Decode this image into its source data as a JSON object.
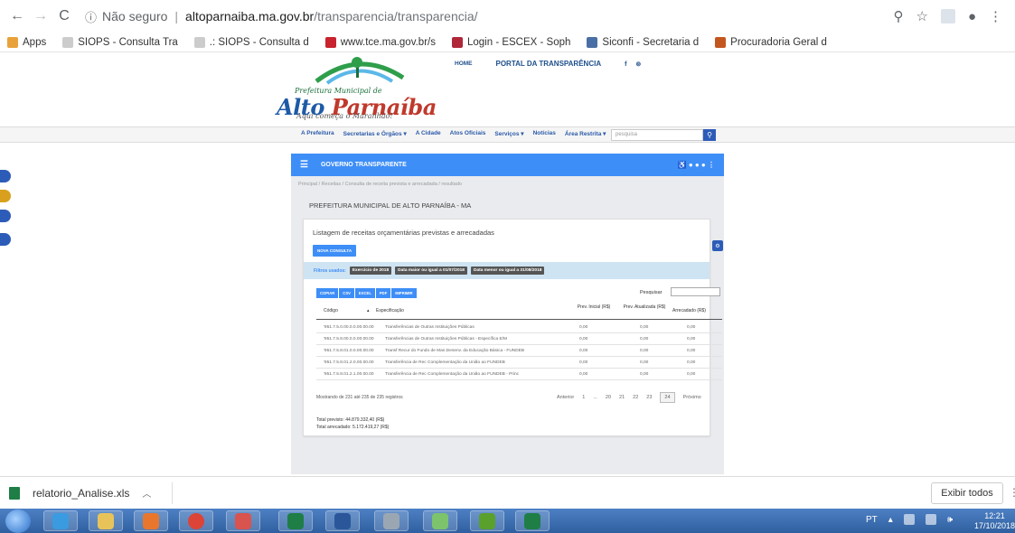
{
  "browser": {
    "security_label": "Não seguro",
    "url_domain": "altoparnaiba.ma.gov.br",
    "url_path": "/transparencia/transparencia/",
    "bookmarks": [
      {
        "label": "Apps",
        "color": "#e9a23b"
      },
      {
        "label": "SIOPS - Consulta Tra",
        "color": "#cccccc"
      },
      {
        "label": ".: SIOPS - Consulta d",
        "color": "#cccccc"
      },
      {
        "label": "www.tce.ma.gov.br/s",
        "color": "#c9232d"
      },
      {
        "label": "Login - ESCEX - Soph",
        "color": "#b0273a"
      },
      {
        "label": "Siconfi - Secretaria d",
        "color": "#4a6fa5"
      },
      {
        "label": "Procuradoria Geral d",
        "color": "#c3561e"
      }
    ]
  },
  "site": {
    "logo": {
      "subtitle": "Prefeitura Municipal de",
      "name_part1": "Alto",
      "name_part2": "Parnaíba",
      "tagline": "Aqui começa o Maranhão!"
    },
    "top_links": {
      "home": "HOME",
      "portal": "PORTAL DA TRANSPARÊNCIA",
      "social": "f ⊚"
    },
    "nav": [
      "A Prefeitura",
      "Secretarias e Órgãos ▾",
      "A Cidade",
      "Atos Oficiais",
      "Serviços ▾",
      "Notícias",
      "Área Restrita ▾"
    ],
    "search_placeholder": "pesquisa"
  },
  "social_colors": [
    "#2d5cb8",
    "#d8a01d",
    "#2d5cb8",
    "#2d5cb8"
  ],
  "panel": {
    "bar_title": "GOVERNO TRANSPARENTE",
    "bar_icons": "♿ ● ● ● ⋮",
    "breadcrumb": "Principal  /  Receitas  /  Consulta de receita prevista e arrecadada  /  resultado",
    "org": "PREFEITURA MUNICIPAL DE ALTO PARNAÍBA - MA",
    "card_title": "Listagem de receitas orçamentárias previstas e arrecadadas",
    "new_query": "NOVA CONSULTA",
    "filters_label": "Filtros usados:",
    "filters": [
      "Exercício de 2018",
      "Data maior ou igual a 01/07/2018",
      "Data menor ou igual a 31/08/2018"
    ],
    "export_buttons": [
      "COPIAR",
      "CSV",
      "EXCEL",
      "PDF",
      "IMPRIMIR"
    ],
    "search_label": "Pesquisar",
    "columns": [
      "Código",
      "Especificação",
      "Prev. Inicial (R$)",
      "Prev. Atualizada (R$)",
      "Arrecadado (R$)"
    ],
    "rows": [
      [
        "'951.7.5.0.00.0.0.00.00.00",
        "Transferências de Outras Instituições Públicas",
        "0,00",
        "0,00",
        "0,00"
      ],
      [
        "'951.7.5.8.00.0.0.00.00.00",
        "Transferências de Outras Instituições Públicas - Específica E/M",
        "0,00",
        "0,00",
        "0,00"
      ],
      [
        "'951.7.5.8.01.0.0.00.00.00",
        "Transf Recur do Fundo de Man.Desenv. da Educação Básica - FUNDEB",
        "0,00",
        "0,00",
        "0,00"
      ],
      [
        "'951.7.5.8.01.2.0.00.00.00",
        "Transferência de Rec Complementação da União ao FUNDEB",
        "0,00",
        "0,00",
        "0,00"
      ],
      [
        "'951.7.5.8.01.2.1.00.00.00",
        "Transferência de Rec Complementação da União ao FUNDEB - Princ",
        "0,00",
        "0,00",
        "0,00"
      ]
    ],
    "records_info": "Mostrando de 231 até 235 de 235 registros",
    "pager": [
      "Anterior",
      "1",
      "...",
      "20",
      "21",
      "22",
      "23",
      "24",
      "Próximo"
    ],
    "pager_active": "24",
    "total_previsto": "Total previsto: 44.879.332,40 (R$)",
    "total_arrecadado": "Total arrecadado: 5.172.419,27 (R$)"
  },
  "downloads": {
    "file": "relatorio_Analise.xls",
    "show_all": "Exibir todos"
  },
  "taskbar": {
    "lang": "PT",
    "time": "12:21",
    "date": "17/10/2018",
    "apps": [
      {
        "name": "ie",
        "color": "#3a9be0"
      },
      {
        "name": "explorer",
        "color": "#e8c35a"
      },
      {
        "name": "media",
        "color": "#e8772d"
      },
      {
        "name": "chrome",
        "color": "#db4437"
      },
      {
        "name": "tool",
        "color": "#d9534f"
      },
      {
        "name": "excel",
        "color": "#1e7e45"
      },
      {
        "name": "word",
        "color": "#2b579a"
      },
      {
        "name": "calc",
        "color": "#9aa7b3"
      },
      {
        "name": "game",
        "color": "#7cc36c"
      },
      {
        "name": "bug",
        "color": "#5aa02c"
      },
      {
        "name": "excel2",
        "color": "#1e7e45"
      }
    ]
  }
}
